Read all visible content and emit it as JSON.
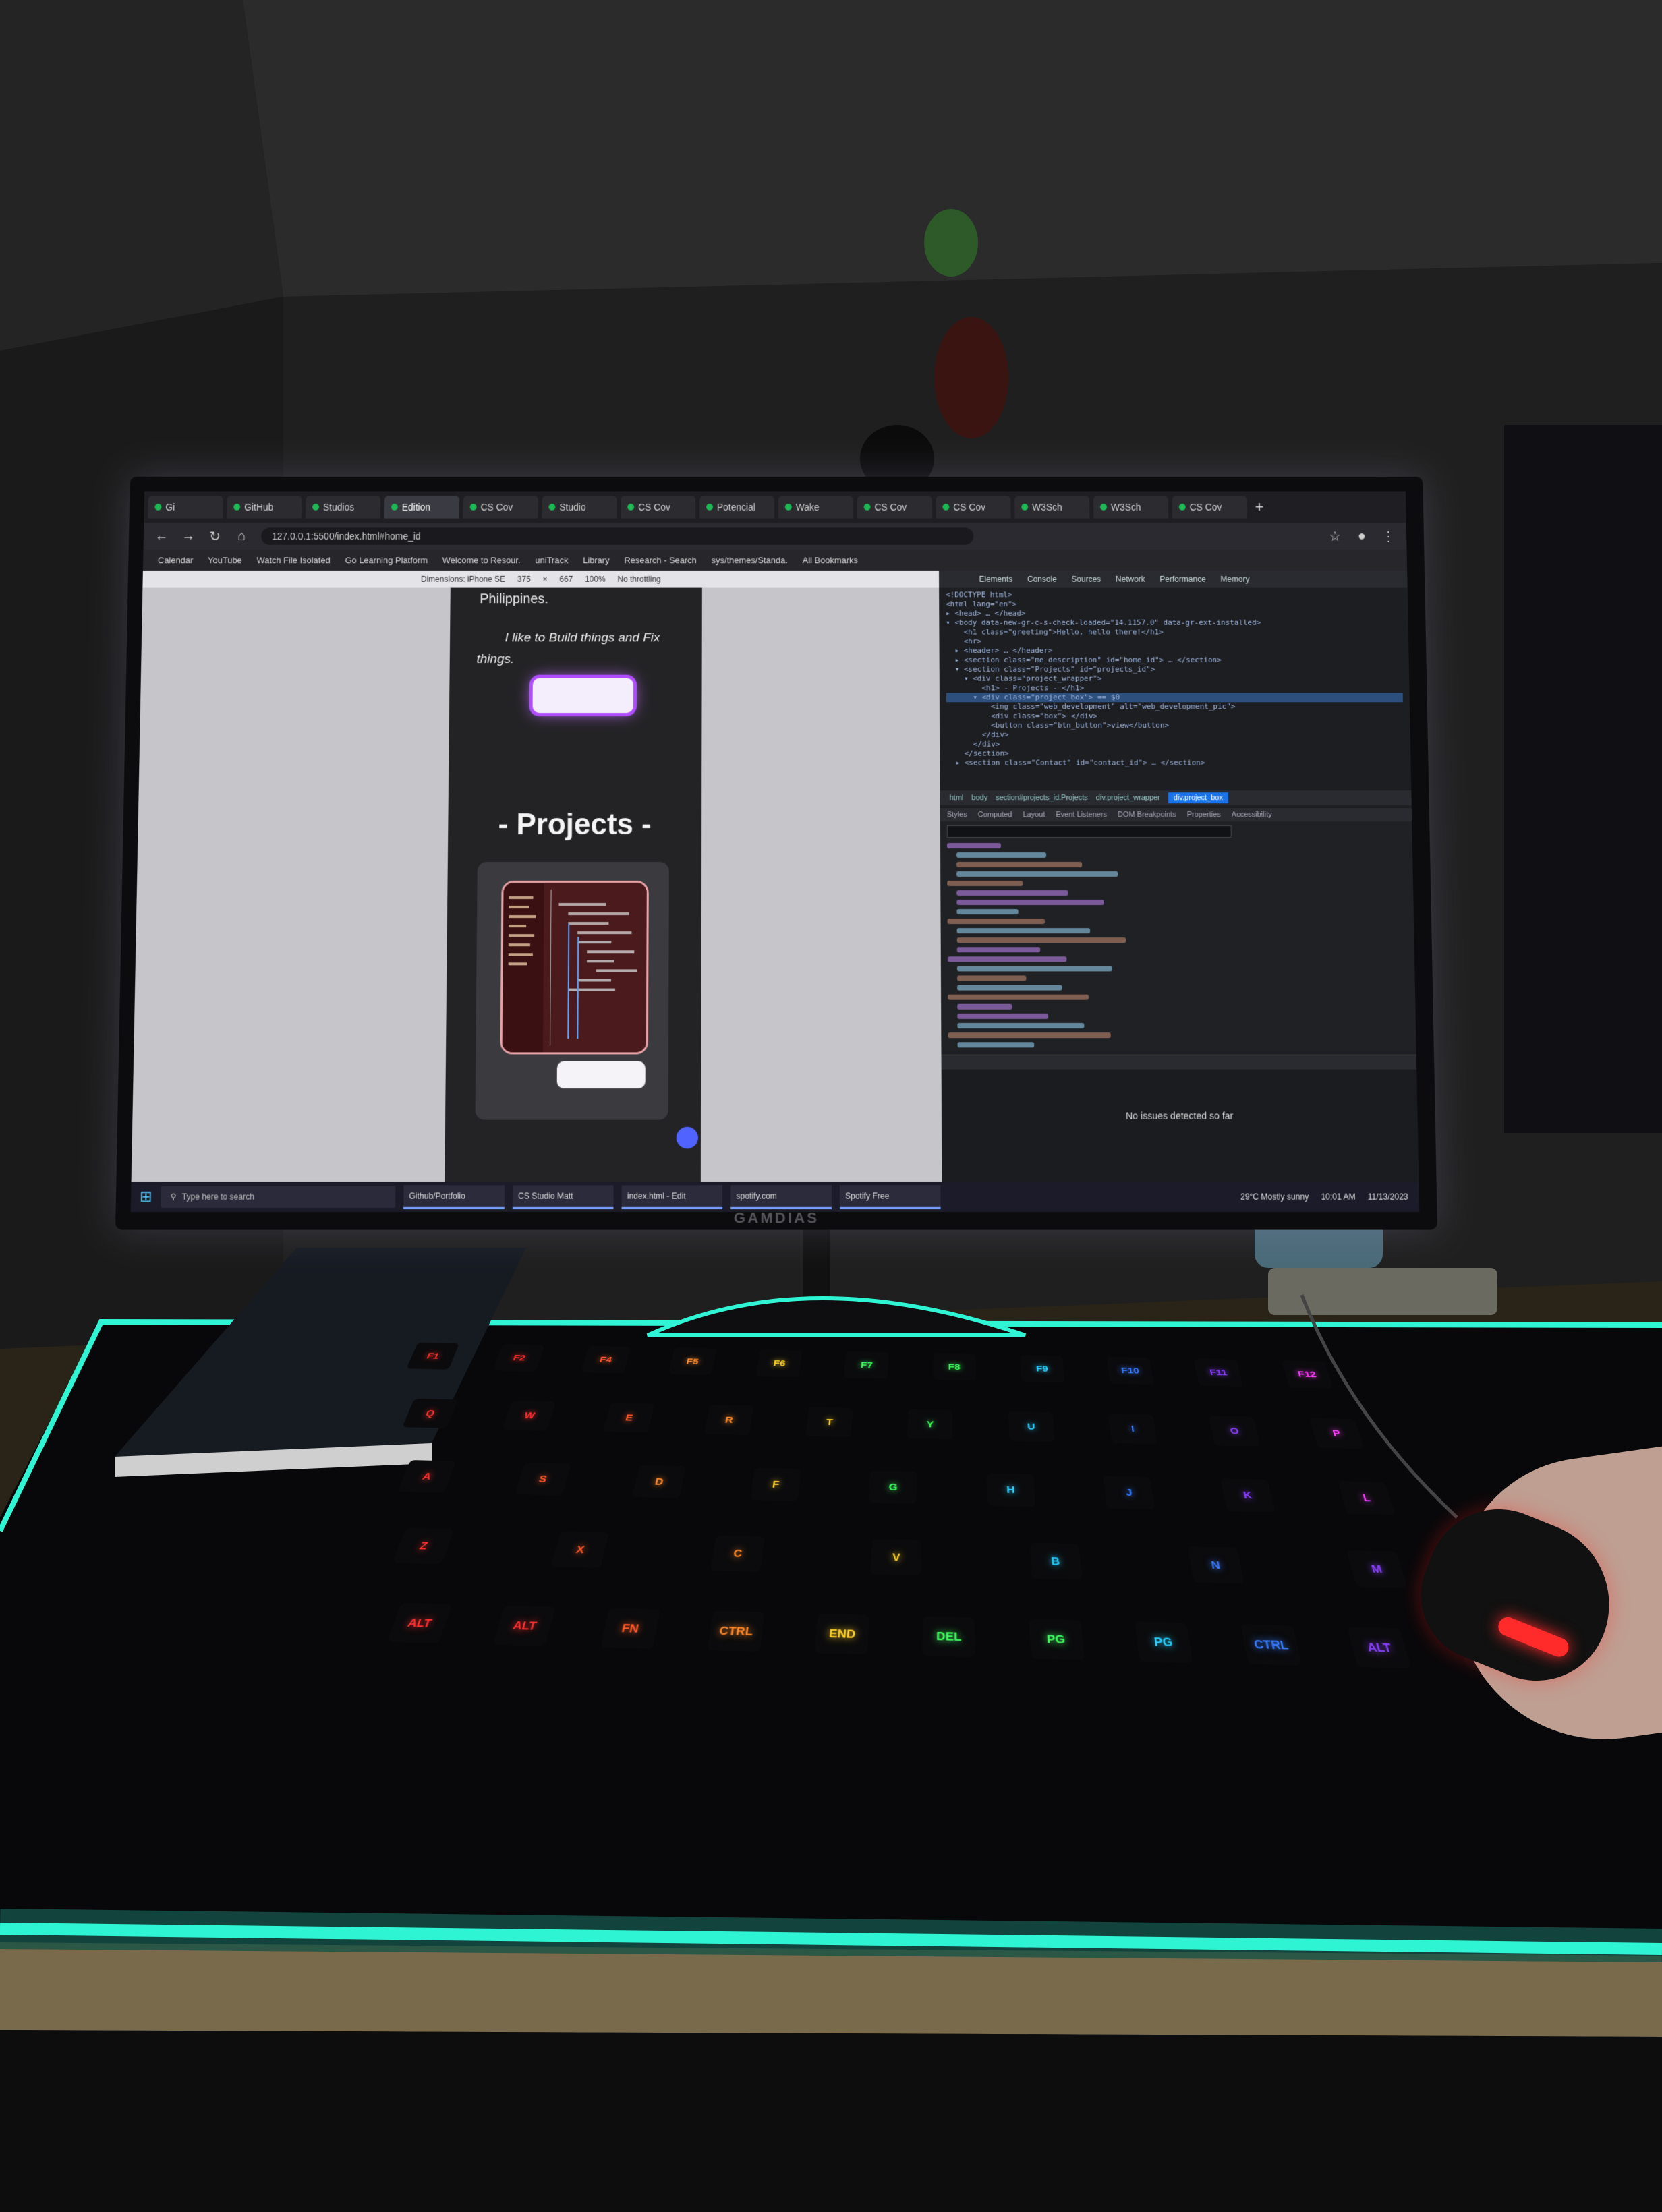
{
  "tabs": [
    {
      "label": "Gi",
      "active": false
    },
    {
      "label": "GitHub",
      "active": false
    },
    {
      "label": "Studios",
      "active": false
    },
    {
      "label": "Edition",
      "active": true
    },
    {
      "label": "CS Cov",
      "active": false
    },
    {
      "label": "Studio",
      "active": false
    },
    {
      "label": "CS Cov",
      "active": false
    },
    {
      "label": "Potencial",
      "active": false
    },
    {
      "label": "Wake",
      "active": false
    },
    {
      "label": "CS Cov",
      "active": false
    },
    {
      "label": "CS Cov",
      "active": false
    },
    {
      "label": "W3Sch",
      "active": false
    },
    {
      "label": "W3Sch",
      "active": false
    },
    {
      "label": "CS Cov",
      "active": false
    }
  ],
  "browser": {
    "url": "127.0.0.1:5500/index.html#home_id"
  },
  "bookmarks": [
    "Calendar",
    "YouTube",
    "Watch File Isolated",
    "Go Learning Platform",
    "Welcome to Resour.",
    "uniTrack",
    "Library",
    "Research - Search",
    "sys/themes/Standa.",
    "All Bookmarks"
  ],
  "devbar": {
    "dimensions": "Dimensions: iPhone SE",
    "width": "375",
    "height": "667",
    "zoom": "100%",
    "throttle": "No throttling"
  },
  "page": {
    "intro_end": "Philippines.",
    "tagline": "I like to Build things and Fix things.",
    "projects_heading": "- Projects -"
  },
  "devtools": {
    "tabs": [
      "Elements",
      "Console",
      "Sources",
      "Network",
      "Performance",
      "Memory"
    ],
    "code_lines": [
      "<!DOCTYPE html>",
      "<html lang=\"en\">",
      "▸ <head> … </head>",
      "▾ <body data-new-gr-c-s-check-loaded=\"14.1157.0\" data-gr-ext-installed>",
      "    <h1 class=\"greeting\">Hello, hello there!</h1>",
      "    <hr>",
      "  ▸ <header> … </header>",
      "  ▸ <section class=\"me_description\" id=\"home_id\"> … </section>",
      "  ▾ <section class=\"Projects\" id=\"projects_id\">",
      "    ▾ <div class=\"project_wrapper\">",
      "        <h1> - Projects - </h1>",
      "      ▾ <div class=\"project_box\"> == $0",
      "          <img class=\"web_development\" alt=\"web_development_pic\">",
      "          <div class=\"box\"> </div>",
      "          <button class=\"btn_button\">view</button>",
      "        </div>",
      "      </div>",
      "    </section>",
      "  ▸ <section class=\"Contact\" id=\"contact_id\"> … </section>"
    ],
    "breadcrumb": [
      "html",
      "body",
      "section#projects_id.Projects",
      "div.project_wrapper"
    ],
    "breadcrumb_active": "div.project_box",
    "style_tabs": [
      "Styles",
      "Computed",
      "Layout",
      "Event Listeners",
      "DOM Breakpoints",
      "Properties",
      "Accessibility"
    ],
    "console_message": "No issues detected so far"
  },
  "taskbar": {
    "search_placeholder": "Type here to search",
    "apps": [
      "Github/Portfolio",
      "CS Studio Matt",
      "index.html - Edit",
      "spotify.com",
      "Spotify Free"
    ],
    "weather": "29°C Mostly sunny",
    "time": "10:01 AM",
    "date": "11/13/2023"
  },
  "monitor": {
    "brand": "GAMDIAS"
  },
  "keyboard": {
    "keys": [
      "F1",
      "F2",
      "F4",
      "F5",
      "F6",
      "F7",
      "F8",
      "F9",
      "F10",
      "F11",
      "F12",
      "Q",
      "W",
      "E",
      "R",
      "T",
      "Y",
      "U",
      "I",
      "O",
      "P",
      "A",
      "S",
      "D",
      "F",
      "G",
      "H",
      "J",
      "K",
      "L",
      "Z",
      "X",
      "C",
      "V",
      "B",
      "N",
      "M",
      "ALT",
      "ALT",
      "FN",
      "CTRL",
      "END",
      "DEL",
      "PG",
      "PG",
      "CTRL",
      "ALT",
      "FN"
    ],
    "colors": [
      "#ff3030",
      "#ff5a2a",
      "#ff8a2a",
      "#ffd02a",
      "#40ff60",
      "#2ad0ff",
      "#3a7bff",
      "#8a40ff",
      "#ff40ff"
    ]
  },
  "ambient": {
    "led_strip_color": "#2ff5d4",
    "mouse_led_color": "#ff2a2a"
  }
}
